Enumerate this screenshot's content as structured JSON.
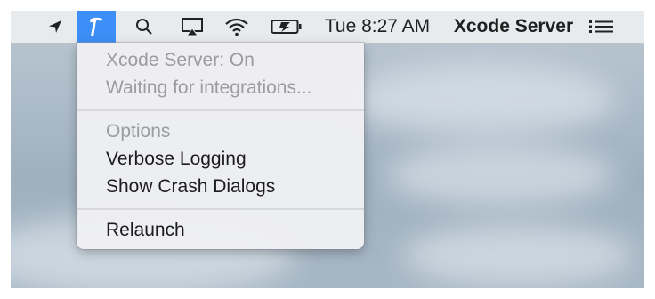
{
  "menubar": {
    "icons": [
      "location-arrow-icon",
      "xcode-server-icon",
      "spotlight-search-icon",
      "airplay-icon",
      "wifi-icon",
      "battery-charging-icon",
      "list-menu-icon"
    ],
    "clock": "Tue 8:27 AM",
    "app_name": "Xcode Server",
    "active_color": "#3d8ef7"
  },
  "menu": {
    "status_line": "Xcode Server: On",
    "waiting_line": "Waiting for integrations...",
    "options_header": "Options",
    "verbose_logging": "Verbose Logging",
    "show_crash_dialogs": "Show Crash Dialogs",
    "relaunch": "Relaunch"
  }
}
